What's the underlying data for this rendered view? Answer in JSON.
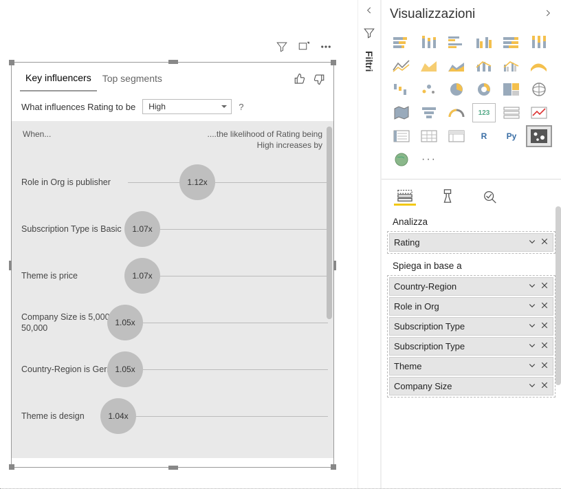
{
  "visual": {
    "tabs": {
      "key_influencers": "Key influencers",
      "top_segments": "Top segments"
    },
    "question_prefix": "What influences Rating to be",
    "question_value": "High",
    "question_help": "?",
    "header_left": "When...",
    "header_right": "....the likelihood of Rating being High increases by",
    "influencers": [
      {
        "label": "Role in Org is publisher",
        "value": "1.12x",
        "offset": 230
      },
      {
        "label": "Subscription Type is Basic",
        "value": "1.07x",
        "offset": 150
      },
      {
        "label": "Theme is price",
        "value": "1.07x",
        "offset": 150
      },
      {
        "label": "Company Size is 5,000 - 50,000",
        "value": "1.05x",
        "offset": 125
      },
      {
        "label": "Country-Region is Germany",
        "value": "1.05x",
        "offset": 125
      },
      {
        "label": "Theme is design",
        "value": "1.04x",
        "offset": 115
      }
    ]
  },
  "filters_pane": {
    "title": "Filtri"
  },
  "viz_pane": {
    "title": "Visualizzazioni",
    "section_analyze": "Analizza",
    "analyze_fields": [
      "Rating"
    ],
    "section_explain": "Spiega in base a",
    "explain_fields": [
      "Country-Region",
      "Role in Org",
      "Subscription Type",
      "Subscription Type",
      "Theme",
      "Company Size"
    ],
    "gallery_text": {
      "r": "R",
      "py": "Py",
      "card": "123"
    }
  }
}
